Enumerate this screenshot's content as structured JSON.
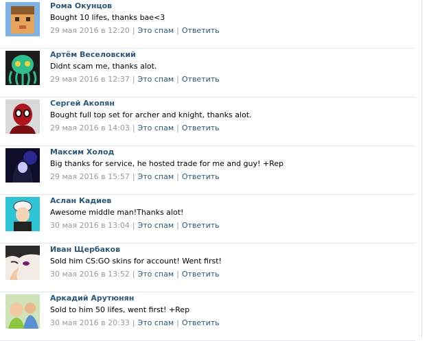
{
  "comments": [
    {
      "author": "Рома Окунцов",
      "text": "Bought 10 lifes, thanks bae<3",
      "time": "29 мая 2016 в 12:20",
      "spam": "Это спам",
      "reply": "Ответить"
    },
    {
      "author": "Артём Веселовский",
      "text": "Didnt scam me, thanks alot.",
      "time": "29 мая 2016 в 12:37",
      "spam": "Это спам",
      "reply": "Ответить"
    },
    {
      "author": "Сергей Акопян",
      "text": "Bought full top set for archer and knight, thanks alot.",
      "time": "29 мая 2016 в 14:03",
      "spam": "Это спам",
      "reply": "Ответить"
    },
    {
      "author": "Максим Холод",
      "text": "Big thanks for service, he hosted trade for me and guy! +Rep",
      "time": "29 мая 2016 в 15:57",
      "spam": "Это спам",
      "reply": "Ответить"
    },
    {
      "author": "Аслан Кадиев",
      "text": "Awesome middle man!Thanks alot!",
      "time": "30 мая 2016 в 13:04",
      "spam": "Это спам",
      "reply": "Ответить"
    },
    {
      "author": "Иван Щербаков",
      "text": "Sold him CS:GO skins for account! Went first!",
      "time": "30 мая 2016 в 13:52",
      "spam": "Это спам",
      "reply": "Ответить"
    },
    {
      "author": "Аркадий Арутюнян",
      "text": "Sold to him 50 lifes, went first! +Rep",
      "time": "30 мая 2016 в 20:33",
      "spam": "Это спам",
      "reply": "Ответить"
    }
  ],
  "colors": {
    "link": "#2b587a",
    "meta": "#999999",
    "divider": "#e3e7ec"
  }
}
